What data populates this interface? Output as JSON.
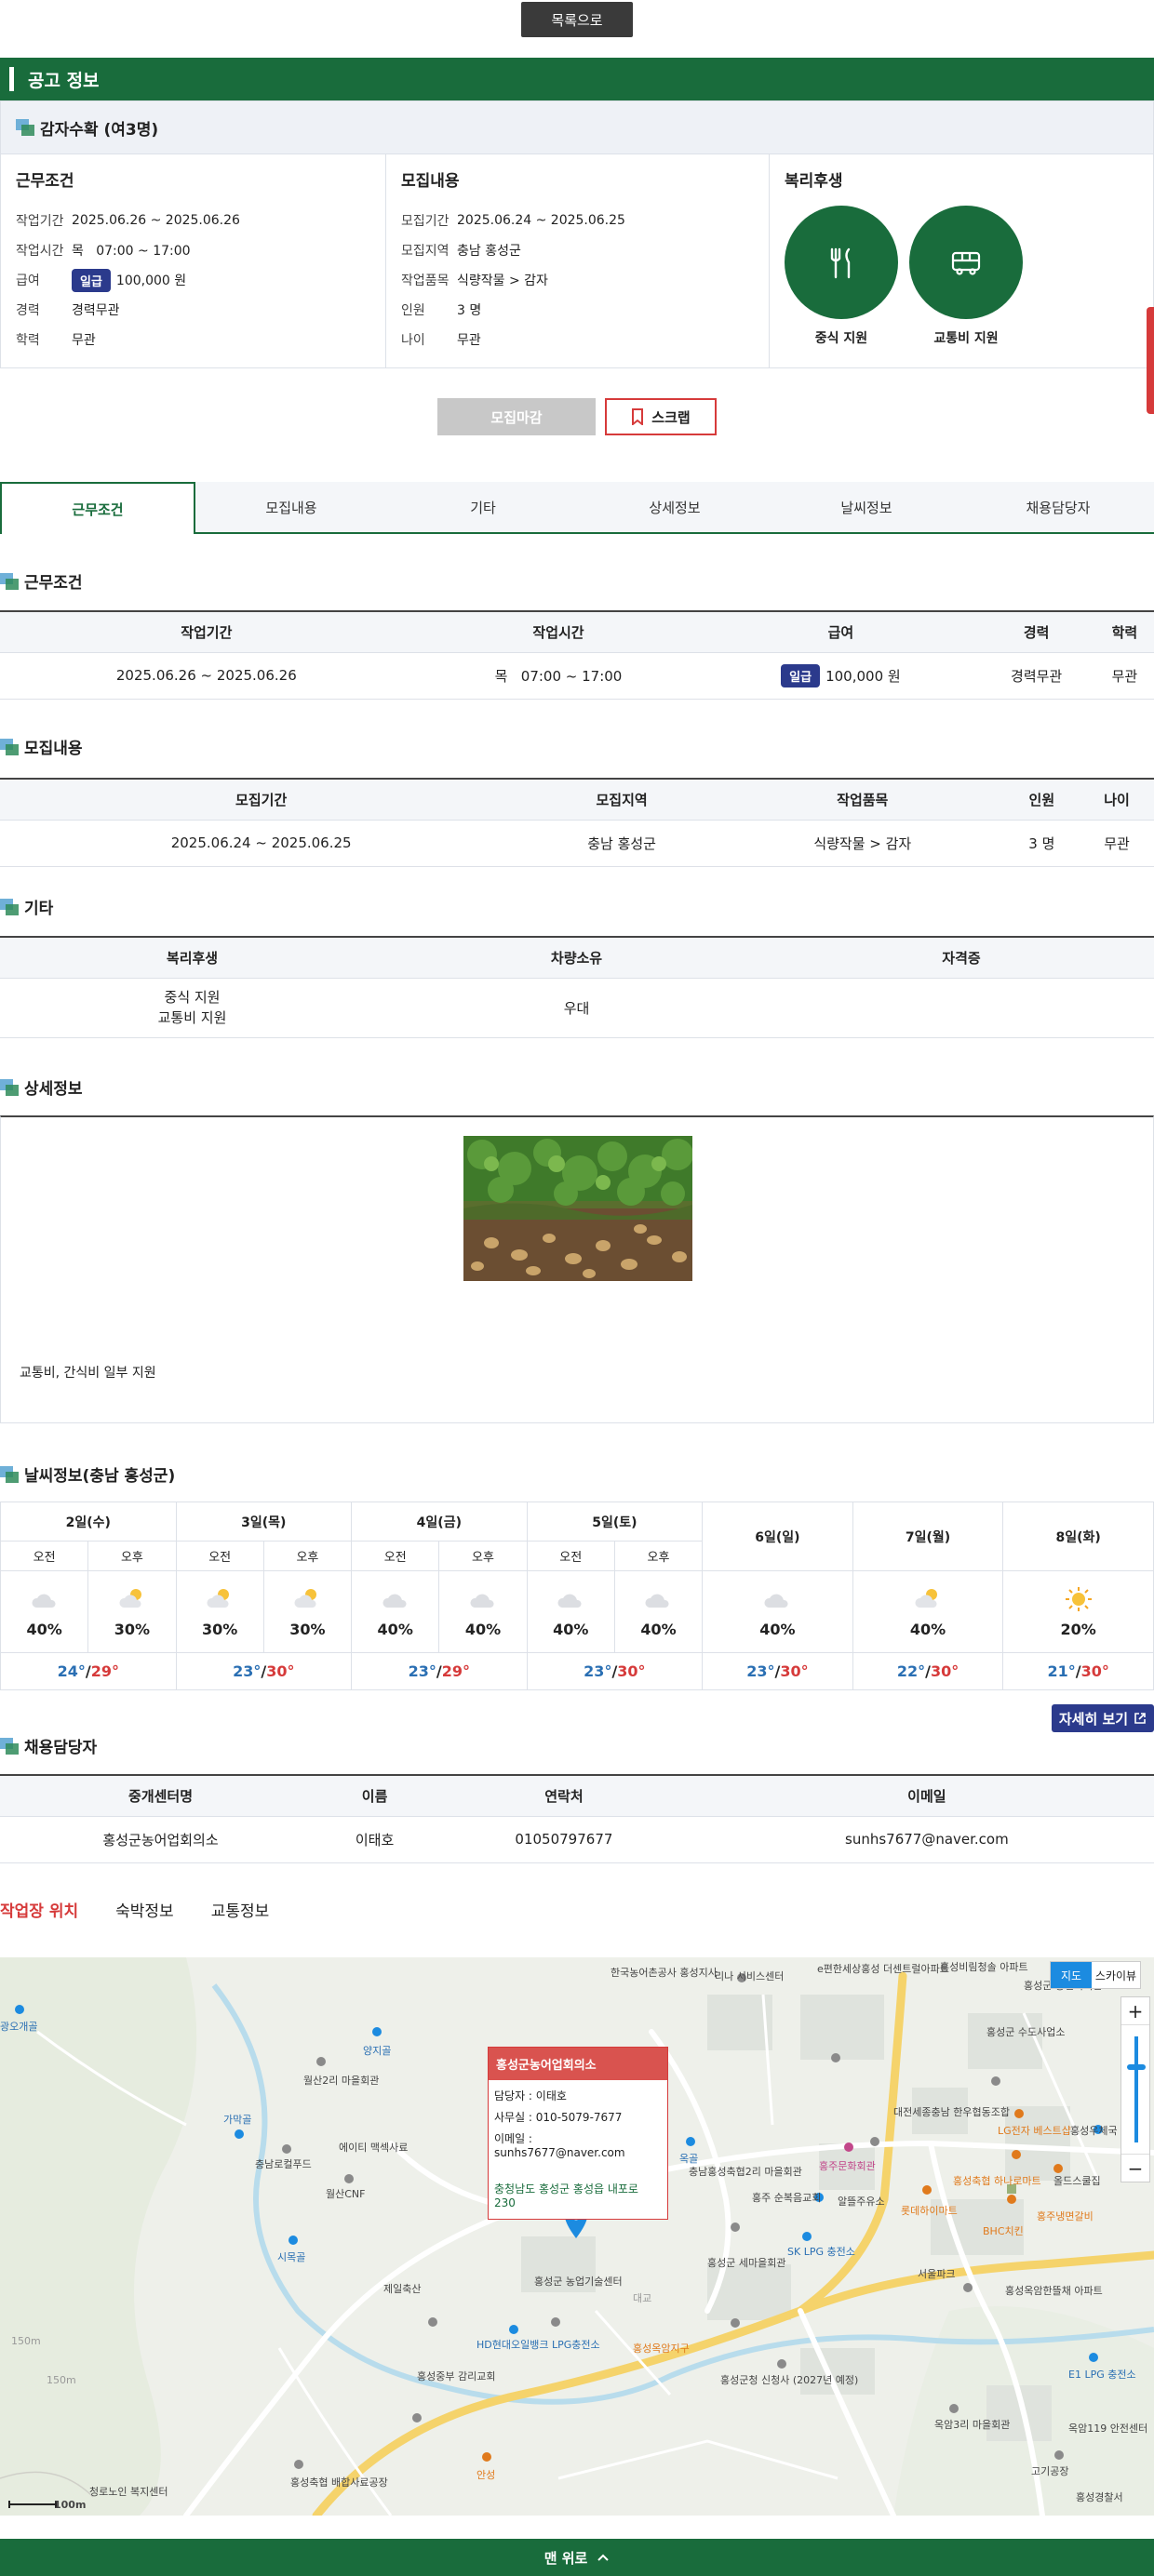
{
  "top": {
    "list_button": "목록으로"
  },
  "notice": {
    "title": "공고 정보"
  },
  "job": {
    "title": "감자수확 (여3명)"
  },
  "summary": {
    "work": {
      "heading": "근무조건",
      "rows": [
        {
          "k": "작업기간",
          "v": "2025.06.26 ~ 2025.06.26"
        },
        {
          "k": "작업시간",
          "v": "목   07:00 ~ 17:00"
        },
        {
          "k": "급여",
          "pill": "일급",
          "v": "100,000 원"
        },
        {
          "k": "경력",
          "v": "경력무관"
        },
        {
          "k": "학력",
          "v": "무관"
        }
      ]
    },
    "recruit": {
      "heading": "모집내용",
      "rows": [
        {
          "k": "모집기간",
          "v": "2025.06.24 ~ 2025.06.25"
        },
        {
          "k": "모집지역",
          "v": "충남 홍성군"
        },
        {
          "k": "작업품목",
          "v": "식량작물 > 감자"
        },
        {
          "k": "인원",
          "v": "3 명"
        },
        {
          "k": "나이",
          "v": "무관"
        }
      ]
    },
    "benefit": {
      "heading": "복리후생",
      "items": [
        {
          "label": "중식 지원",
          "icon": "utensils-icon"
        },
        {
          "label": "교통비 지원",
          "icon": "bus-icon"
        }
      ]
    }
  },
  "actions": {
    "closed": "모집마감",
    "scrap": "스크랩"
  },
  "tabs": [
    "근무조건",
    "모집내용",
    "기타",
    "상세정보",
    "날씨정보",
    "채용담당자"
  ],
  "sections": {
    "work": {
      "title": "근무조건",
      "headers": [
        "작업기간",
        "작업시간",
        "급여",
        "경력",
        "학력"
      ],
      "row": {
        "period": "2025.06.26 ~ 2025.06.26",
        "day": "목",
        "time": "07:00 ~ 17:00",
        "pay_pill": "일급",
        "pay": "100,000 원",
        "career": "경력무관",
        "edu": "무관"
      }
    },
    "recruit": {
      "title": "모집내용",
      "headers": [
        "모집기간",
        "모집지역",
        "작업품목",
        "인원",
        "나이"
      ],
      "row": [
        "2025.06.24 ~ 2025.06.25",
        "충남 홍성군",
        "식량작물 > 감자",
        "3 명",
        "무관"
      ]
    },
    "etc": {
      "title": "기타",
      "headers": [
        "복리후생",
        "차량소유",
        "자격증"
      ],
      "benefit_lines": [
        "중식 지원",
        "교통비 지원"
      ],
      "vehicle": "우대",
      "license": ""
    },
    "detail": {
      "title": "상세정보",
      "text": "교통비, 간식비 일부 지원"
    },
    "weather": {
      "title": "날씨정보(충남 홍성군)",
      "am": "오전",
      "pm": "오후",
      "split_days": [
        {
          "day": "2일(수)",
          "am": {
            "pct": "40%",
            "icon": "cloud-icon"
          },
          "pm": {
            "pct": "30%",
            "icon": "sun-cloud-icon"
          },
          "lo": "24°",
          "hi": "29°"
        },
        {
          "day": "3일(목)",
          "am": {
            "pct": "30%",
            "icon": "sun-cloud-icon"
          },
          "pm": {
            "pct": "30%",
            "icon": "sun-cloud-icon"
          },
          "lo": "23°",
          "hi": "30°"
        },
        {
          "day": "4일(금)",
          "am": {
            "pct": "40%",
            "icon": "cloud-icon"
          },
          "pm": {
            "pct": "40%",
            "icon": "cloud-icon"
          },
          "lo": "23°",
          "hi": "29°"
        },
        {
          "day": "5일(토)",
          "am": {
            "pct": "40%",
            "icon": "cloud-icon"
          },
          "pm": {
            "pct": "40%",
            "icon": "cloud-icon"
          },
          "lo": "23°",
          "hi": "30°"
        }
      ],
      "single_days": [
        {
          "day": "6일(일)",
          "pct": "40%",
          "icon": "cloud-icon",
          "lo": "23°",
          "hi": "30°"
        },
        {
          "day": "7일(월)",
          "pct": "40%",
          "icon": "sun-cloud-icon",
          "lo": "22°",
          "hi": "30°"
        },
        {
          "day": "8일(화)",
          "pct": "20%",
          "icon": "sun-icon",
          "lo": "21°",
          "hi": "30°"
        }
      ],
      "more": "자세히 보기"
    },
    "contact": {
      "title": "채용담당자",
      "headers": [
        "중개센터명",
        "이름",
        "연락처",
        "이메일"
      ],
      "row": [
        "홍성군농어업회의소",
        "이태호",
        "01050797677",
        "sunhs7677@naver.com"
      ]
    }
  },
  "location_tabs": [
    "작업장 위치",
    "숙박정보",
    "교통정보"
  ],
  "map": {
    "bubble": {
      "title": "홍성군농어업회의소",
      "lines": [
        "담당자 : 이태호",
        "사무실 : 010-5079-7677",
        "이메일 : sunhs7677@naver.com"
      ],
      "address": "충청남도 홍성군 홍성읍 내포로 230"
    },
    "type_on": "지도",
    "type_off": "스카이뷰",
    "scale": "100m",
    "labels": [
      "한국농어촌공사 홍성지사",
      "리나 서비스센터",
      "e편한세상홍성 더센트럴아파트",
      "홍성비림청솔 아파트",
      "홍성군 농업복지관",
      "양지골",
      "월산2리 마을회관",
      "가막골",
      "충남로컬푸드",
      "에이티 맥섹사료",
      "월산CNF",
      "홍성군 수도사업소",
      "대전세종충남 한우협동조합",
      "LG전자 베스트샵",
      "홍성우체국",
      "옥골",
      "충남홍성축협2리 마을회관",
      "홍주문화회관",
      "홍성축협 하나로마트",
      "올드스쿨집",
      "홍주냉면갈비",
      "시목골",
      "제일축산",
      "홍성군 농업기술센터",
      "홍성군 세마을회관",
      "SK LPG 충전소",
      "서울파크",
      "홍성옥암한뜰채 아파트",
      "HD현대오일뱅크 LPG충전소",
      "홍성옥암지구",
      "홍성중부 감리교회",
      "홍성군청 신청사 (2027년 예정)",
      "E1 LPG 충전소",
      "옥암3리 마을회관",
      "옥암119 안전센터",
      "고기공장",
      "홍성경찰서",
      "홍성축협 배합사료공장",
      "청로노인 복지센터",
      "안성",
      "150m",
      "150m",
      "롯데하이마트",
      "BHC치킨",
      "홍주 순복음교회",
      "알뜰주유소",
      "대교",
      "광오개골"
    ]
  },
  "bottom": {
    "top_button": "맨 위로"
  }
}
